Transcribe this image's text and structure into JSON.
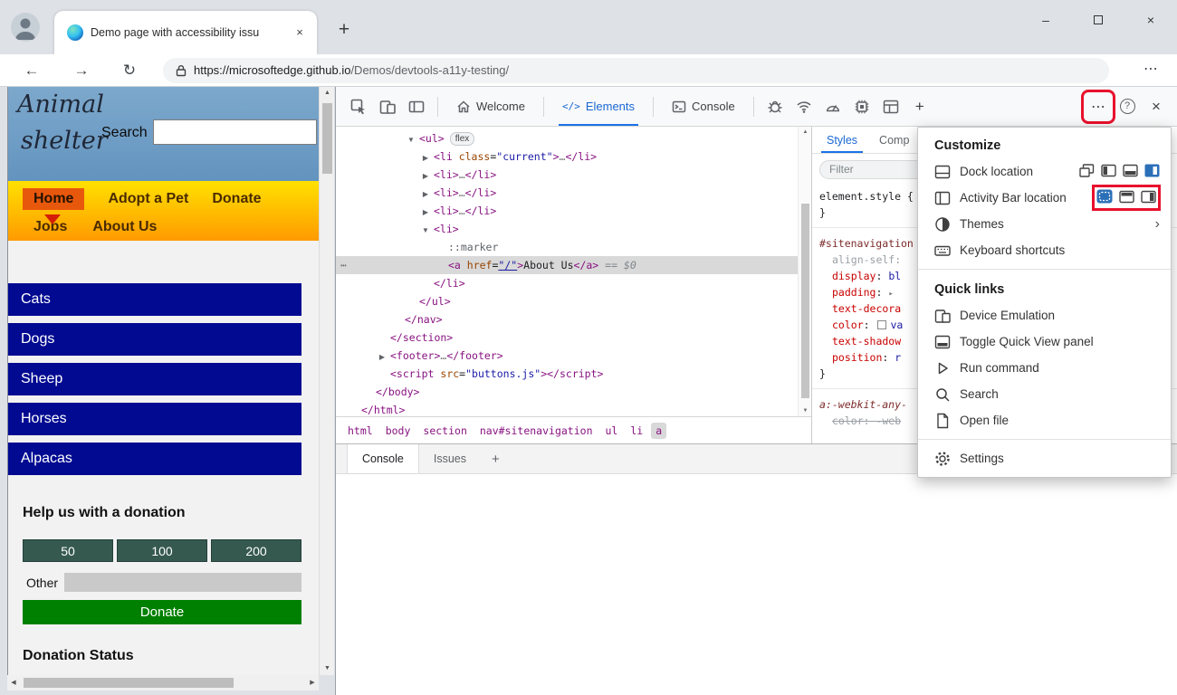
{
  "icons": {
    "more": "⋯",
    "help": "?",
    "close": "×",
    "back": "←",
    "forward": "→",
    "refresh": "↻",
    "plus": "+",
    "minimize": "–",
    "submenu": "›",
    "collapse": "▼",
    "expand": "▶",
    "up": "▲",
    "down": "▼",
    "left": "◀",
    "right": "▶",
    "elements_tab": "</>"
  },
  "colors": {
    "accent_blue": "#1a73e8",
    "highlight_red": "#e8112d",
    "navy": "#010a91",
    "header_blue": "#6d9bc3",
    "donate_green": "#008000",
    "amount_green": "#35594f"
  },
  "browser": {
    "tab_title": "Demo page with accessibility issu",
    "url_host": "https://microsoftedge.github.io",
    "url_path": "/Demos/devtools-a11y-testing/"
  },
  "site": {
    "title1": "Animal",
    "title2": "shelter",
    "search_label": "Search",
    "nav1": [
      "Home",
      "Adopt a Pet",
      "Donate"
    ],
    "nav2": [
      "Jobs",
      "About Us"
    ],
    "animals": [
      "Cats",
      "Dogs",
      "Sheep",
      "Horses",
      "Alpacas"
    ],
    "donation": {
      "heading": "Help us with a donation",
      "amounts": [
        "50",
        "100",
        "200"
      ],
      "other": "Other",
      "donate": "Donate",
      "status": "Donation Status"
    }
  },
  "devtools": {
    "tabs": {
      "welcome": "Welcome",
      "elements": "Elements",
      "console": "Console"
    },
    "tree": [
      {
        "i": 4,
        "a": "v",
        "k": [
          [
            "t",
            "<ul>"
          ],
          [
            "b",
            "flex"
          ]
        ]
      },
      {
        "i": 5,
        "a": "r",
        "k": [
          [
            "t",
            "<li"
          ],
          [
            "a",
            " class"
          ],
          [
            "x",
            "="
          ],
          [
            "v",
            "\"current\""
          ],
          [
            "t",
            ">"
          ],
          [
            "d",
            "…"
          ],
          [
            "t",
            "</li>"
          ]
        ]
      },
      {
        "i": 5,
        "a": "r",
        "k": [
          [
            "t",
            "<li>"
          ],
          [
            "d",
            "…"
          ],
          [
            "t",
            "</li>"
          ]
        ]
      },
      {
        "i": 5,
        "a": "r",
        "k": [
          [
            "t",
            "<li>"
          ],
          [
            "d",
            "…"
          ],
          [
            "t",
            "</li>"
          ]
        ]
      },
      {
        "i": 5,
        "a": "r",
        "k": [
          [
            "t",
            "<li>"
          ],
          [
            "d",
            "…"
          ],
          [
            "t",
            "</li>"
          ]
        ]
      },
      {
        "i": 5,
        "a": "v",
        "k": [
          [
            "t",
            "<li>"
          ]
        ]
      },
      {
        "i": 6,
        "k": [
          [
            "m",
            "::marker"
          ]
        ]
      },
      {
        "i": 6,
        "sel": true,
        "k": [
          [
            "t",
            "<a"
          ],
          [
            "a",
            " href"
          ],
          [
            "x",
            "="
          ],
          [
            "u",
            "\"/\""
          ],
          [
            "t",
            ">"
          ],
          [
            "x",
            "About Us"
          ],
          [
            "t",
            "</a>"
          ],
          [
            "g",
            " == $0"
          ]
        ]
      },
      {
        "i": 5,
        "k": [
          [
            "t",
            "</li>"
          ]
        ]
      },
      {
        "i": 4,
        "k": [
          [
            "t",
            "</ul>"
          ]
        ]
      },
      {
        "i": 3,
        "k": [
          [
            "t",
            "</nav>"
          ]
        ]
      },
      {
        "i": 2,
        "k": [
          [
            "t",
            "</section>"
          ]
        ]
      },
      {
        "i": 2,
        "a": "r",
        "k": [
          [
            "t",
            "<footer>"
          ],
          [
            "d",
            "…"
          ],
          [
            "t",
            "</footer>"
          ]
        ]
      },
      {
        "i": 2,
        "k": [
          [
            "t",
            "<script"
          ],
          [
            "a",
            " src"
          ],
          [
            "x",
            "="
          ],
          [
            "v",
            "\"buttons.js\""
          ],
          [
            "t",
            "></script>"
          ]
        ]
      },
      {
        "i": 1,
        "k": [
          [
            "t",
            "</body>"
          ]
        ]
      },
      {
        "i": 0,
        "k": [
          [
            "t",
            "</html>"
          ]
        ]
      }
    ],
    "breadcrumbs": [
      "html",
      "body",
      "section",
      "nav#sitenavigation",
      "ul",
      "li",
      "a"
    ],
    "styles": {
      "tab_styles": "Styles",
      "tab_computed": "Comp",
      "filter_placeholder": "Filter",
      "lines": [
        {
          "i": 0,
          "k": [
            [
              "p",
              "element.style {"
            ]
          ]
        },
        {
          "i": 0,
          "k": [
            [
              "p",
              "}"
            ]
          ]
        },
        {
          "sep": true
        },
        {
          "i": 0,
          "k": [
            [
              "s",
              "#sitenavigation"
            ]
          ]
        },
        {
          "i": 1,
          "k": [
            [
              "dim",
              "align-self:"
            ]
          ]
        },
        {
          "i": 1,
          "k": [
            [
              "pr",
              "display"
            ],
            [
              "p",
              ": "
            ],
            [
              "va",
              "bl"
            ]
          ]
        },
        {
          "i": 1,
          "k": [
            [
              "pr",
              "padding"
            ],
            [
              "p",
              ": "
            ],
            [
              "ar",
              "▸"
            ]
          ]
        },
        {
          "i": 1,
          "k": [
            [
              "pr",
              "text-decora"
            ]
          ]
        },
        {
          "i": 1,
          "k": [
            [
              "pr",
              "color"
            ],
            [
              "p",
              ": "
            ],
            [
              "sw",
              ""
            ],
            [
              "va",
              "va"
            ]
          ]
        },
        {
          "i": 1,
          "k": [
            [
              "pr",
              "text-shadow"
            ]
          ]
        },
        {
          "i": 1,
          "k": [
            [
              "pr",
              "position"
            ],
            [
              "p",
              ": "
            ],
            [
              "va",
              "r"
            ]
          ]
        },
        {
          "i": 0,
          "k": [
            [
              "p",
              "}"
            ]
          ]
        },
        {
          "sep": true
        },
        {
          "i": 0,
          "k": [
            [
              "si",
              "a:-webkit-any-"
            ]
          ]
        },
        {
          "i": 1,
          "k": [
            [
              "str",
              "color: -web"
            ]
          ]
        }
      ]
    },
    "drawer": {
      "console": "Console",
      "issues": "Issues"
    },
    "menu": {
      "header": "Customize",
      "dock_location": "Dock location",
      "activity_bar": "Activity Bar location",
      "themes": "Themes",
      "keyboard": "Keyboard shortcuts",
      "quick_links": "Quick links",
      "device_emulation": "Device Emulation",
      "quick_view": "Toggle Quick View panel",
      "run_command": "Run command",
      "search": "Search",
      "open_file": "Open file",
      "settings": "Settings"
    }
  }
}
